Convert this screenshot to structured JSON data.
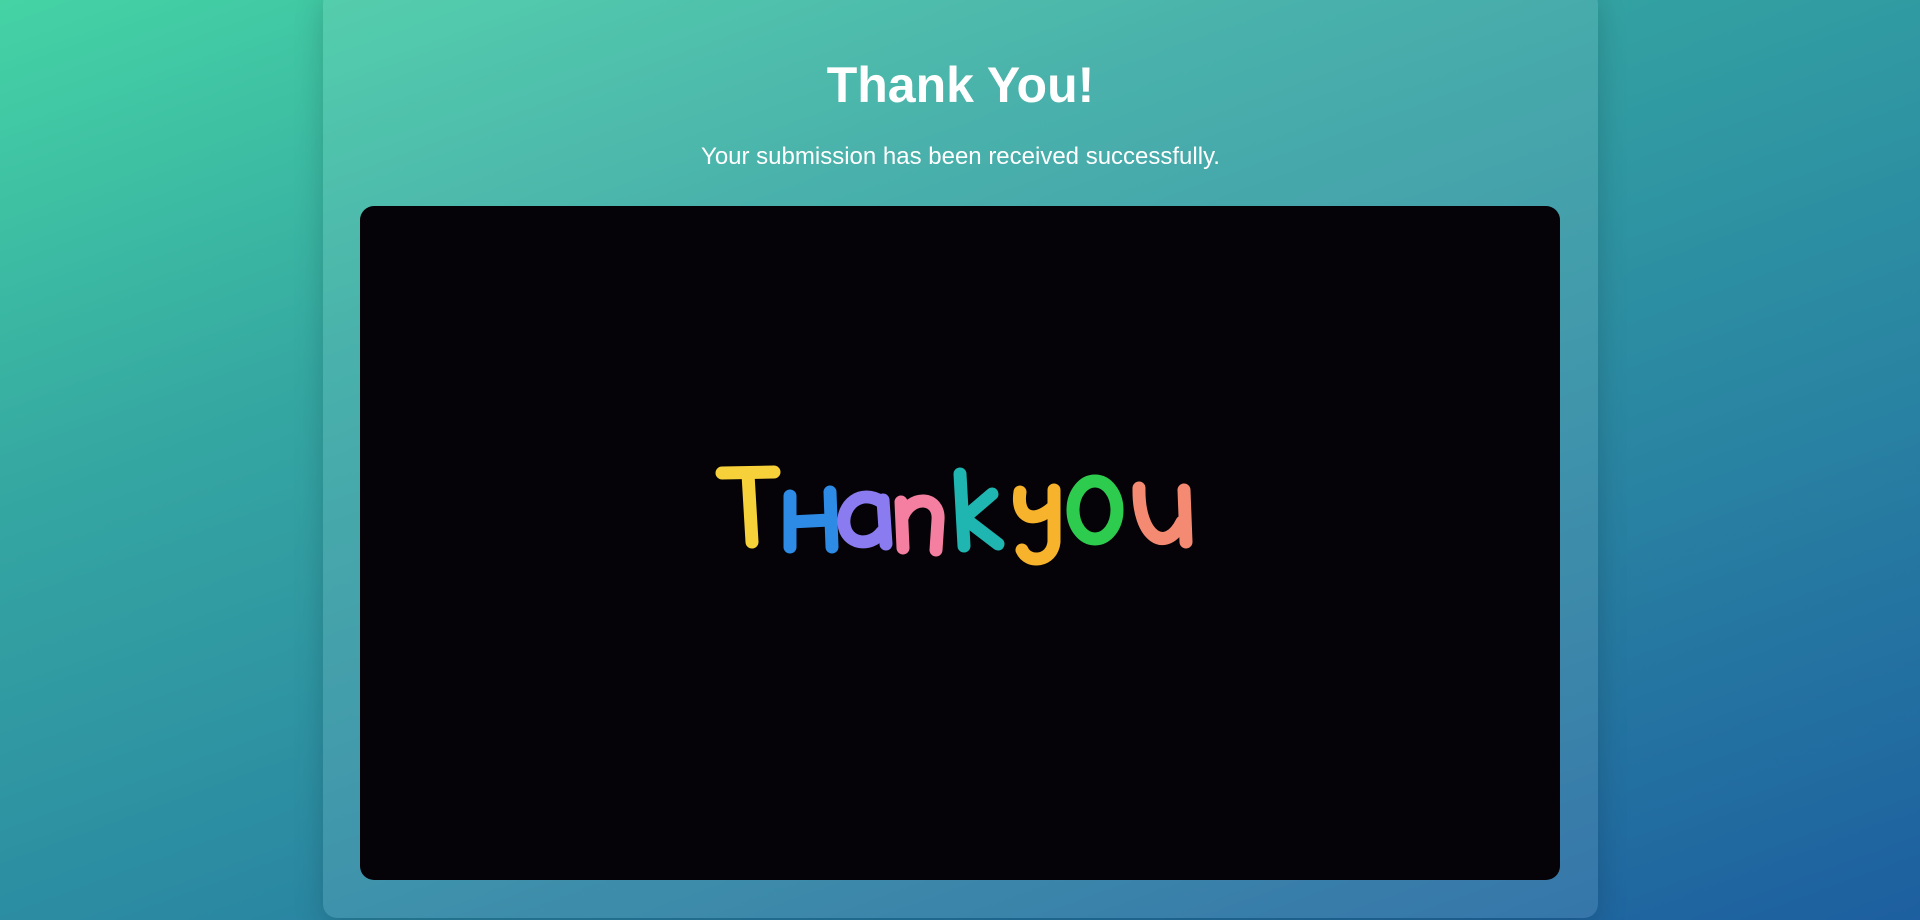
{
  "page": {
    "title": "Thank You!",
    "subtitle": "Your submission has been received successfully."
  },
  "media": {
    "caption_text": "Thank you",
    "letter_colors": [
      "#f7d13a",
      "#2d8ae5",
      "#8a7cf0",
      "#f57fa0",
      "#1fb5b0",
      "#f7b32b",
      "#2ecc4e",
      "#f58a72"
    ]
  },
  "theme": {
    "background_start": "#45d3a4",
    "background_end": "#1d5fa0",
    "media_background": "#050307"
  }
}
